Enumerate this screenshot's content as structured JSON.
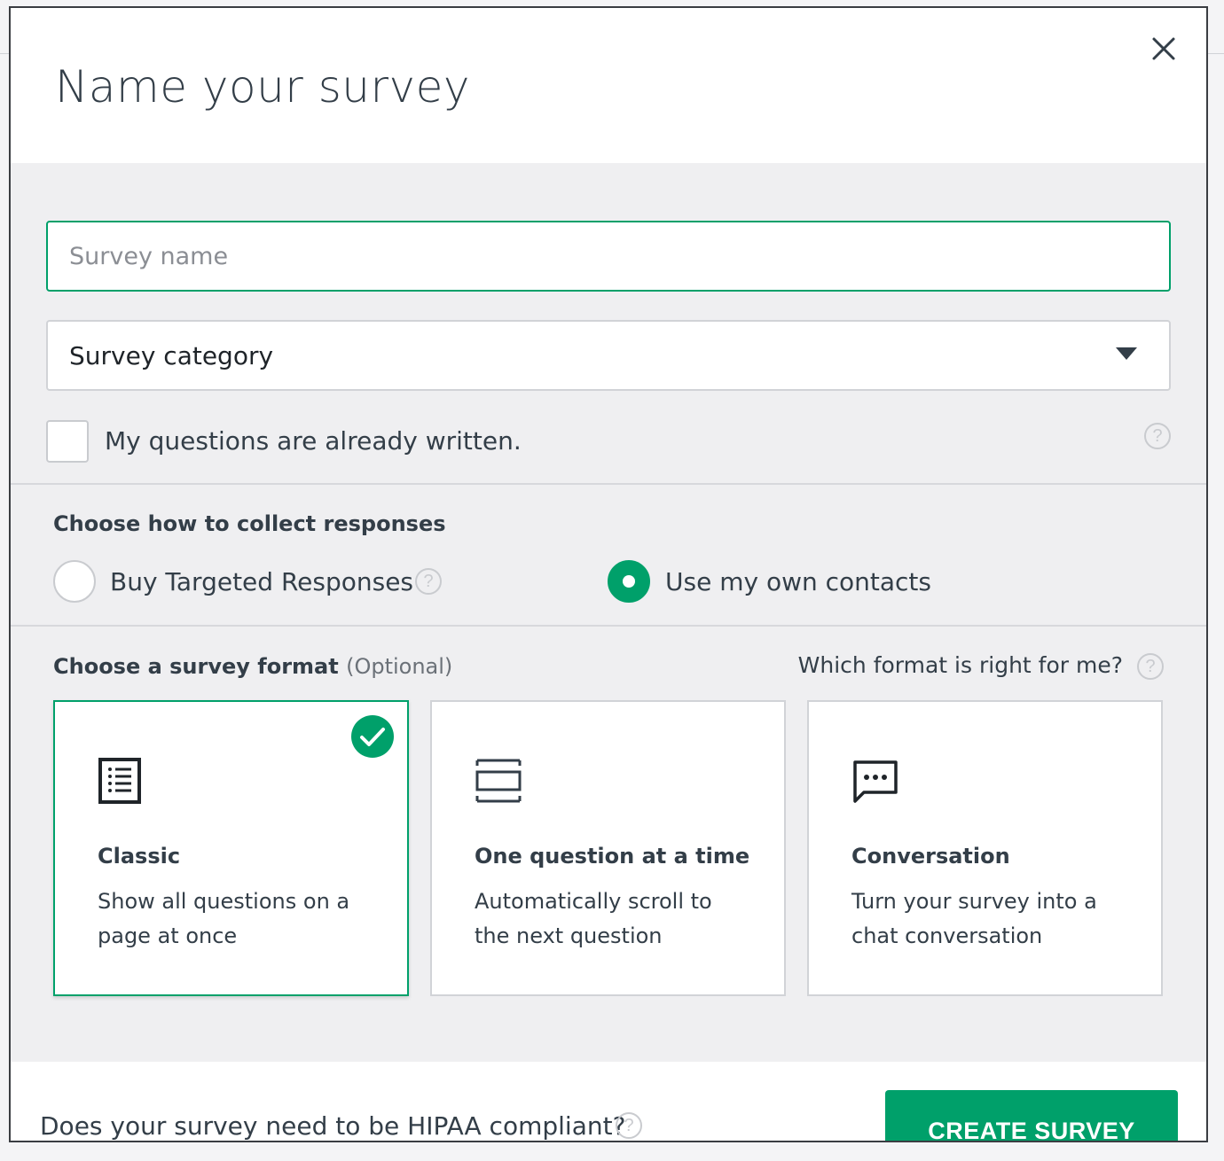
{
  "dialog": {
    "title": "Name your survey",
    "close_icon": "close-icon"
  },
  "form": {
    "survey_name_placeholder": "Survey name",
    "survey_name_value": "",
    "category_label": "Survey category",
    "questions_written_label": "My questions are already written.",
    "questions_written_checked": false
  },
  "collect": {
    "title": "Choose how to collect responses",
    "options": [
      {
        "label": "Buy Targeted Responses",
        "selected": false
      },
      {
        "label": "Use my own contacts",
        "selected": true
      }
    ]
  },
  "format": {
    "title": "Choose a survey format",
    "optional": "(Optional)",
    "help_text": "Which format is right for me?",
    "cards": [
      {
        "icon": "list-icon",
        "title": "Classic",
        "description": "Show all questions on a page at once",
        "selected": true
      },
      {
        "icon": "scroll-stack-icon",
        "title": "One question at a time",
        "description": "Automatically scroll to the next question",
        "selected": false
      },
      {
        "icon": "chat-bubble-icon",
        "title": "Conversation",
        "description": "Turn your survey into a chat conversation",
        "selected": false
      }
    ]
  },
  "footer": {
    "hipaa_question": "Does your survey need to be HIPAA compliant?",
    "create_label": "CREATE SURVEY"
  },
  "colors": {
    "accent": "#00a06a",
    "text": "#333e48",
    "panel_bg": "#efeff1",
    "border": "#d1d3d7"
  }
}
